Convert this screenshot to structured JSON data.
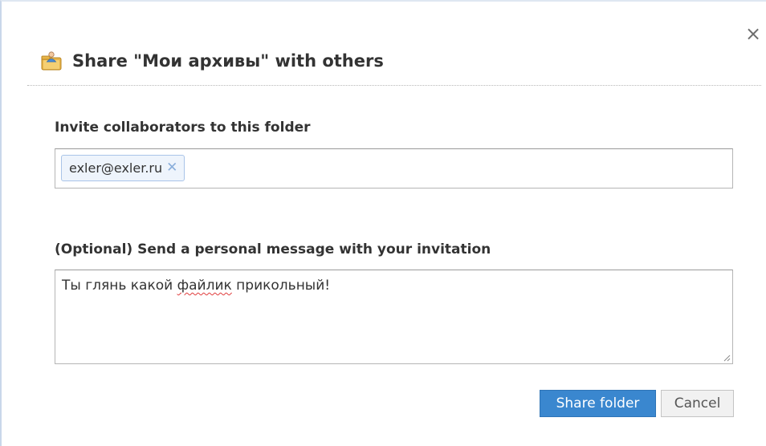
{
  "dialog": {
    "title": "Share \"Мои архивы\" with others",
    "title_icon": "shared-folder-icon",
    "close_glyph": "×"
  },
  "invite": {
    "label": "Invite collaborators to this folder",
    "chips": [
      {
        "email": "exler@exler.ru",
        "remove_glyph": "✕"
      }
    ]
  },
  "message": {
    "label": "(Optional) Send a personal message with your invitation",
    "text_before": "Ты глянь какой ",
    "text_misspelled": "файлик",
    "text_after": " прикольный!"
  },
  "buttons": {
    "share_label": "Share folder",
    "cancel_label": "Cancel"
  },
  "colors": {
    "primary_button": "#3a87cf",
    "chip_background": "#eef4fc",
    "chip_border": "#a9c4e8",
    "spellcheck_underline": "#e03c3c"
  }
}
